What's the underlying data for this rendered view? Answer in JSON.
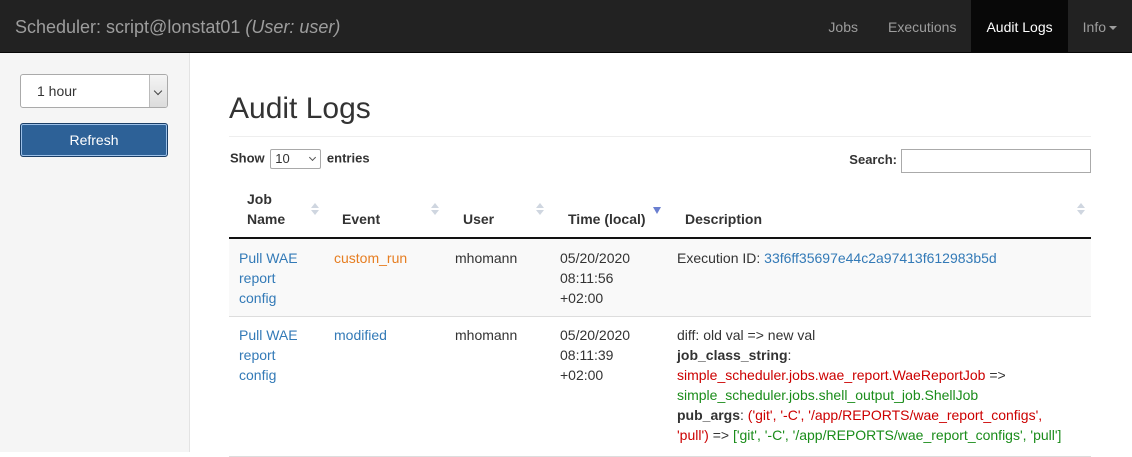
{
  "navbar": {
    "brand": "Scheduler: script@lonstat01",
    "brand_user": "(User: user)",
    "links": [
      {
        "label": "Jobs",
        "active": false
      },
      {
        "label": "Executions",
        "active": false
      },
      {
        "label": "Audit Logs",
        "active": true
      },
      {
        "label": "Info",
        "active": false
      }
    ]
  },
  "sidebar": {
    "time_range": {
      "value": "1 hour"
    },
    "refresh_label": "Refresh"
  },
  "main": {
    "title": "Audit Logs",
    "length": {
      "prefix": "Show",
      "value": "10",
      "suffix": "entries"
    },
    "search": {
      "label": "Search:",
      "value": ""
    }
  },
  "table": {
    "columns": [
      "Job Name",
      "Event",
      "User",
      "Time (local)",
      "Description"
    ],
    "rows": [
      {
        "job_name": [
          "Pull WAE",
          "report",
          "config"
        ],
        "event": "custom_run",
        "user": "mhomann",
        "time": [
          "05/20/2020",
          "08:11:56",
          "+02:00"
        ],
        "description": {
          "prefix": "Execution ID: ",
          "execution_id": "33f6ff35697e44c2a97413f612983b5d"
        }
      },
      {
        "job_name": [
          "Pull WAE",
          "report",
          "config"
        ],
        "event": "modified",
        "user": "mhomann",
        "time": [
          "05/20/2020",
          "08:11:39",
          "+02:00"
        ],
        "description": {
          "diff_header": "diff: old val => new val",
          "field1_key": "job_class_string",
          "field1_old": "simple_scheduler.jobs.wae_report.WaeReportJob",
          "arrow": " =>",
          "field1_new": "simple_scheduler.jobs.shell_output_job.ShellJob",
          "field2_key": "pub_args",
          "field2_old_a": "('git', '-C', '/app/REPORTS/wae_report_configs',",
          "field2_old_b": "'pull')",
          "arrow2": " => ",
          "field2_new": "['git', '-C', '/app/REPORTS/wae_report_configs', 'pull']"
        }
      }
    ]
  }
}
